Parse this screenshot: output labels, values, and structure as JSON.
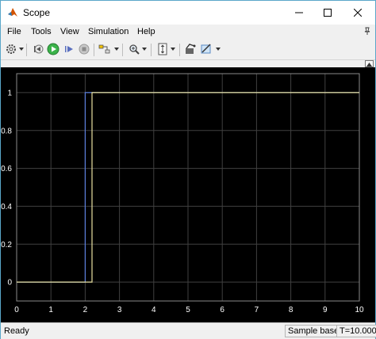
{
  "window": {
    "title": "Scope",
    "minimize_icon": "minimize-icon",
    "maximize_icon": "maximize-icon",
    "close_icon": "close-icon"
  },
  "menu": {
    "items": [
      "File",
      "Tools",
      "View",
      "Simulation",
      "Help"
    ],
    "pin_icon": "pin-icon"
  },
  "toolbar": {
    "icons": [
      "settings-icon",
      "step-back-icon",
      "run-icon",
      "step-forward-icon",
      "stop-icon",
      "highlight-icon",
      "zoom-icon",
      "autoscale-icon",
      "signal-icon",
      "style-icon"
    ]
  },
  "status": {
    "left": "Ready",
    "mode": "Sample based",
    "time": "T=10.000"
  },
  "colors": {
    "plot_background": "#000000",
    "grid": "#404040",
    "axes_text": "#ffffff",
    "series1": "#5b7fdc",
    "series2": "#e8e0a0"
  },
  "chart_data": {
    "type": "line",
    "xlim": [
      0,
      10
    ],
    "ylim": [
      -0.1,
      1.1
    ],
    "xticks": [
      "0",
      "1",
      "2",
      "3",
      "4",
      "5",
      "6",
      "7",
      "8",
      "9",
      "10"
    ],
    "yticks": [
      "0",
      "0.2",
      "0.4",
      "0.6",
      "0.8",
      "1"
    ],
    "grid": true,
    "series": [
      {
        "color": "#5b7fdc",
        "x": [
          0,
          2,
          2,
          10
        ],
        "y": [
          0,
          0,
          1,
          1
        ]
      },
      {
        "color": "#e8e0a0",
        "x": [
          0,
          2.2,
          2.2,
          10
        ],
        "y": [
          0,
          0,
          1,
          1
        ]
      }
    ]
  }
}
